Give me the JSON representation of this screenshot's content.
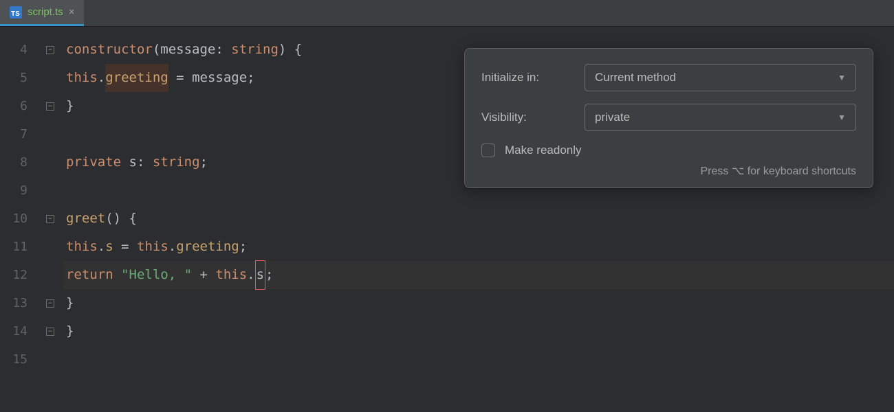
{
  "tab": {
    "filename": "script.ts",
    "ts_badge": "TS"
  },
  "gutter": {
    "numbers": [
      "4",
      "5",
      "6",
      "7",
      "8",
      "9",
      "10",
      "11",
      "12",
      "13",
      "14",
      "15"
    ],
    "folds": [
      "minus",
      "",
      "minus",
      "",
      "",
      "",
      "minus",
      "",
      "",
      "minus",
      "minus",
      ""
    ]
  },
  "code": {
    "l4_kw": "constructor",
    "l4_open": "(",
    "l4_param": "message",
    "l4_colon": ": ",
    "l4_type": "string",
    "l4_close": ") {",
    "l5_this": "this",
    "l5_dot": ".",
    "l5_greet": "greeting",
    "l5_eq": " = ",
    "l5_msg": "message",
    "l5_semi": ";",
    "l6": "}",
    "l8_kw": "private",
    "l8_sp": " ",
    "l8_s": "s",
    "l8_colon": ": ",
    "l8_type": "string",
    "l8_semi": ";",
    "l10_name": "greet",
    "l10_rest": "() {",
    "l11_this1": "this",
    "l11_dot1": ".",
    "l11_s": "s",
    "l11_eq": " = ",
    "l11_this2": "this",
    "l11_dot2": ".",
    "l11_greet": "greeting",
    "l11_semi": ";",
    "l12_kw": "return",
    "l12_sp": " ",
    "l12_str": "\"Hello, \"",
    "l12_plus": " + ",
    "l12_this": "this",
    "l12_dot": ".",
    "l12_s": "s",
    "l12_semi": ";",
    "l13": "}",
    "l14": "}"
  },
  "popup": {
    "init_label": "Initialize in:",
    "init_value": "Current method",
    "vis_label": "Visibility:",
    "vis_value": "private",
    "readonly_label": "Make readonly",
    "hint": "Press ⌥ for keyboard shortcuts"
  }
}
